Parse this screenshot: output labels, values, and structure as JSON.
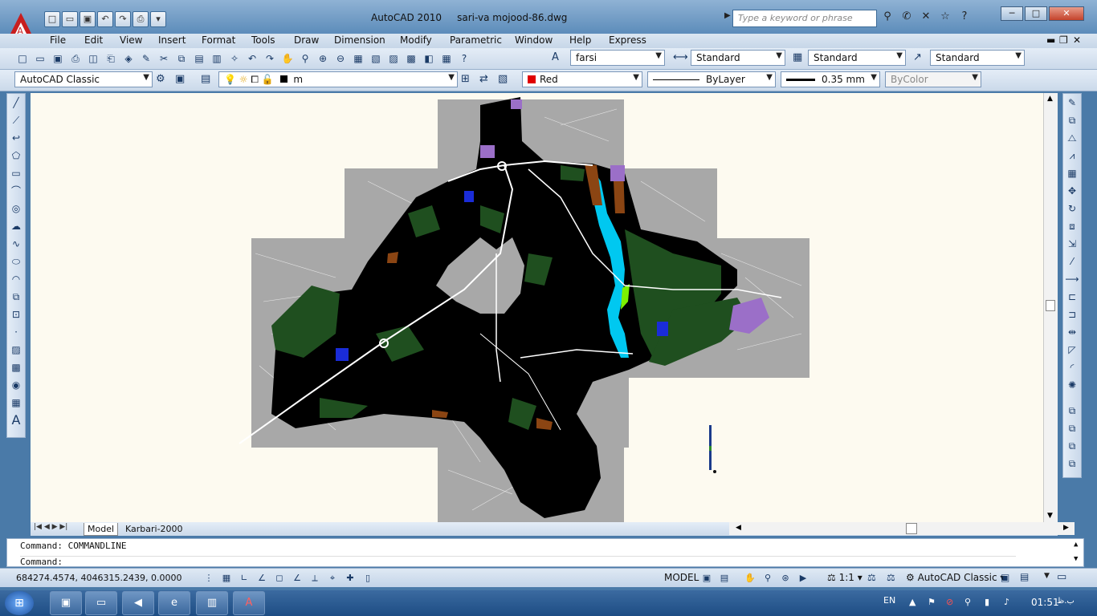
{
  "window": {
    "app_title": "AutoCAD 2010",
    "file_title": "sari-va mojood-86.dwg",
    "search_placeholder": "Type a keyword or phrase"
  },
  "menu": [
    "File",
    "Edit",
    "View",
    "Insert",
    "Format",
    "Tools",
    "Draw",
    "Dimension",
    "Modify",
    "Parametric",
    "Window",
    "Help",
    "Express"
  ],
  "toolbar_styles": {
    "text_style": "farsi",
    "dim_style": "Standard",
    "table_style": "Standard",
    "multileader_style": "Standard"
  },
  "toolbar_layers": {
    "workspace": "AutoCAD Classic",
    "layer": "m",
    "color": "Red",
    "linetype": "ByLayer",
    "lineweight": "0.35 mm",
    "plotstyle": "ByColor"
  },
  "tabs": [
    "Model",
    "Karbari-2000"
  ],
  "command": {
    "history": "Command: COMMANDLINE",
    "prompt": "Command:"
  },
  "status": {
    "coordinates": "684274.4574, 4046315.2439, 0.0000",
    "model_label": "MODEL",
    "annotation_scale": "1:1",
    "workspace": "AutoCAD Classic"
  },
  "taskbar": {
    "language": "EN",
    "time": "01:51",
    "ampm": "ب.ظ"
  },
  "colors": {
    "title_bar": "#6f97c2",
    "canvas_bg": "#fdfaf0",
    "map_black": "#000000",
    "map_green": "#1f4f1f",
    "map_gray": "#a8a8a8",
    "river": "#00c8f0",
    "purple": "#9b6fc8",
    "brown": "#8b4513",
    "layer_color": "#e00000"
  },
  "icons": {
    "draw": [
      "line-icon",
      "construction-line-icon",
      "polyline-icon",
      "polygon-icon",
      "rectangle-icon",
      "arc-icon",
      "circle-icon",
      "revision-cloud-icon",
      "spline-icon",
      "ellipse-icon",
      "ellipse-arc-icon",
      "insert-block-icon",
      "make-block-icon",
      "point-icon",
      "hatch-icon",
      "gradient-icon",
      "region-icon",
      "table-icon",
      "multiline-text-icon"
    ],
    "modify": [
      "erase-icon",
      "copy-icon",
      "mirror-icon",
      "offset-icon",
      "array-icon",
      "move-icon",
      "rotate-icon",
      "scale-icon",
      "stretch-icon",
      "trim-icon",
      "extend-icon",
      "break-at-point-icon",
      "break-icon",
      "join-icon",
      "chamfer-icon",
      "fillet-icon",
      "explode-icon"
    ]
  }
}
